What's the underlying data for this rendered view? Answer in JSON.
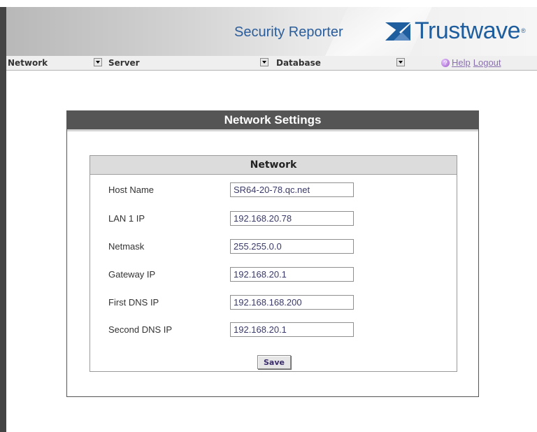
{
  "header": {
    "product_title": "Security Reporter",
    "brand_name": "Trustwave",
    "brand_reg": "®"
  },
  "menubar": {
    "items": [
      {
        "label": "Network"
      },
      {
        "label": "Server"
      },
      {
        "label": "Database"
      }
    ],
    "help_label": "Help",
    "logout_label": "Logout"
  },
  "panel": {
    "title": "Network Settings",
    "section_title": "Network",
    "fields": [
      {
        "label": "Host Name",
        "value": "SR64-20-78.qc.net"
      },
      {
        "label": "LAN 1 IP",
        "value": "192.168.20.78"
      },
      {
        "label": "Netmask",
        "value": "255.255.0.0"
      },
      {
        "label": "Gateway IP",
        "value": "192.168.20.1"
      },
      {
        "label": "First DNS IP",
        "value": "192.168.168.200"
      },
      {
        "label": "Second DNS IP",
        "value": "192.168.20.1"
      }
    ],
    "save_label": "Save"
  },
  "colors": {
    "brand_blue": "#1f5e9e",
    "title_bar": "#555555",
    "link_purple": "#8a6fb0"
  }
}
